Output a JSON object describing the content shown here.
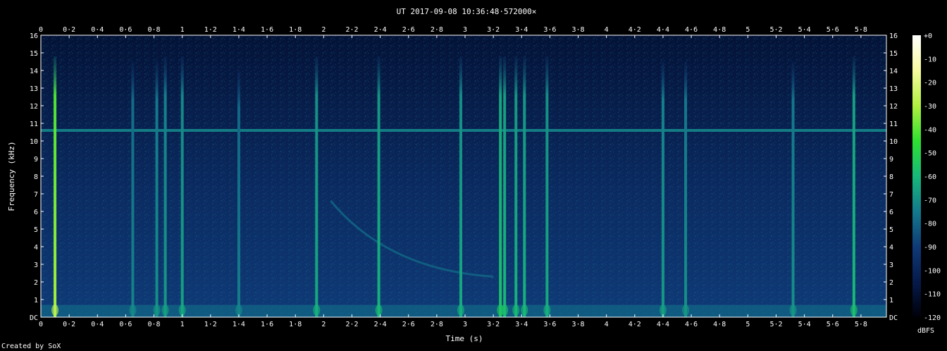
{
  "chart_data": {
    "type": "heatmap",
    "title": "UT 2017-09-08 10:36:48·572000×",
    "xlabel": "Time (s)",
    "ylabel": "Frequency (kHz)",
    "xlim": [
      0,
      5.98
    ],
    "ylim": [
      0,
      16
    ],
    "x_ticks": [
      "0",
      "0·2",
      "0·4",
      "0·6",
      "0·8",
      "1",
      "1·2",
      "1·4",
      "1·6",
      "1·8",
      "2",
      "2·2",
      "2·4",
      "2·6",
      "2·8",
      "3",
      "3·2",
      "3·4",
      "3·6",
      "3·8",
      "4",
      "4·2",
      "4·4",
      "4·6",
      "4·8",
      "5",
      "5·2",
      "5·4",
      "5·6",
      "5·8"
    ],
    "y_ticks": [
      "DC",
      "1",
      "2",
      "3",
      "4",
      "5",
      "6",
      "7",
      "8",
      "9",
      "10",
      "11",
      "12",
      "13",
      "14",
      "15",
      "16"
    ],
    "colorbar": {
      "label": "dBFS",
      "ticks": [
        "+0",
        "-10",
        "-20",
        "-30",
        "-40",
        "-50",
        "-60",
        "-70",
        "-80",
        "-90",
        "-100",
        "-110",
        "-120"
      ],
      "range": [
        -120,
        0
      ],
      "colors": [
        "#000008",
        "#061a4a",
        "#0f3a78",
        "#147a8c",
        "#17b87a",
        "#2ee030",
        "#b0f040",
        "#f8fba0",
        "#ffffff"
      ]
    },
    "background_level_dbfs": -95,
    "tone_line": {
      "freq_khz": 10.6,
      "level_dbfs": -72
    },
    "low_band": {
      "max_freq_khz": 0.7,
      "level_dbfs": -80
    },
    "transients": [
      {
        "time_s": 0.1,
        "max_freq_khz": 14.8,
        "level_dbfs": -35
      },
      {
        "time_s": 0.65,
        "max_freq_khz": 14.5,
        "level_dbfs": -75
      },
      {
        "time_s": 0.82,
        "max_freq_khz": 14.5,
        "level_dbfs": -72
      },
      {
        "time_s": 0.88,
        "max_freq_khz": 14.8,
        "level_dbfs": -70
      },
      {
        "time_s": 1.0,
        "max_freq_khz": 14.8,
        "level_dbfs": -68
      },
      {
        "time_s": 1.4,
        "max_freq_khz": 14.0,
        "level_dbfs": -76
      },
      {
        "time_s": 1.95,
        "max_freq_khz": 14.8,
        "level_dbfs": -66
      },
      {
        "time_s": 2.39,
        "max_freq_khz": 14.8,
        "level_dbfs": -64
      },
      {
        "time_s": 2.97,
        "max_freq_khz": 14.8,
        "level_dbfs": -66
      },
      {
        "time_s": 3.25,
        "max_freq_khz": 14.8,
        "level_dbfs": -60
      },
      {
        "time_s": 3.28,
        "max_freq_khz": 14.8,
        "level_dbfs": -62
      },
      {
        "time_s": 3.36,
        "max_freq_khz": 14.8,
        "level_dbfs": -64
      },
      {
        "time_s": 3.42,
        "max_freq_khz": 14.8,
        "level_dbfs": -64
      },
      {
        "time_s": 3.58,
        "max_freq_khz": 14.8,
        "level_dbfs": -66
      },
      {
        "time_s": 4.4,
        "max_freq_khz": 14.5,
        "level_dbfs": -70
      },
      {
        "time_s": 4.56,
        "max_freq_khz": 14.5,
        "level_dbfs": -72
      },
      {
        "time_s": 5.32,
        "max_freq_khz": 14.5,
        "level_dbfs": -72
      },
      {
        "time_s": 5.75,
        "max_freq_khz": 14.8,
        "level_dbfs": -62
      }
    ],
    "sweep": {
      "start_time_s": 2.05,
      "start_freq_khz": 6.6,
      "end_time_s": 3.2,
      "end_freq_khz": 2.3,
      "level_dbfs": -80
    },
    "grid": false,
    "legend": "none"
  },
  "credit": "Created by SoX"
}
